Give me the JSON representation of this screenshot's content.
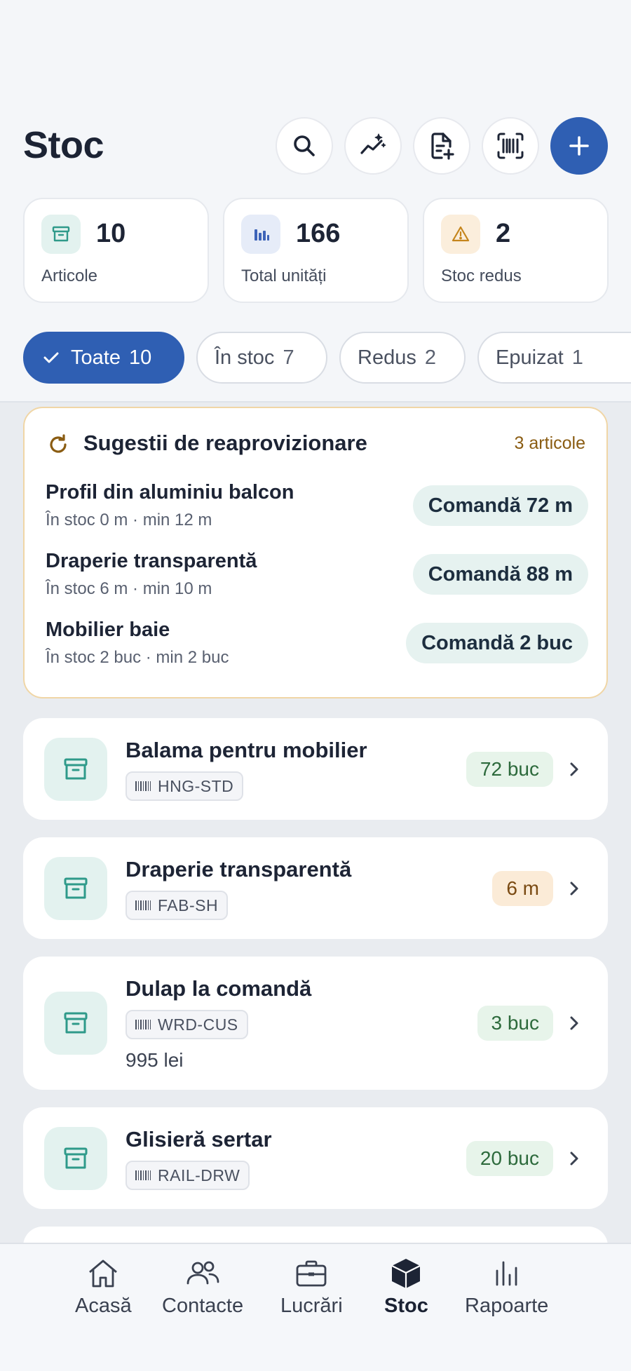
{
  "header": {
    "title": "Stoc",
    "buttons": [
      "search-icon",
      "trend-sparkle-icon",
      "add-document-icon",
      "barcode-scan-icon",
      "plus-icon"
    ]
  },
  "stats": [
    {
      "value": "10",
      "label": "Articole",
      "icon": "archive-icon",
      "color": "#2f9a8a"
    },
    {
      "value": "166",
      "label": "Total unități",
      "icon": "bar-chart-icon",
      "color": "#3d63b8"
    },
    {
      "value": "2",
      "label": "Stoc redus",
      "icon": "warning-icon",
      "color": "#c5851c"
    }
  ],
  "filters": [
    {
      "label": "Toate",
      "count": "10",
      "active": true
    },
    {
      "label": "În stoc",
      "count": "7"
    },
    {
      "label": "Redus",
      "count": "2"
    },
    {
      "label": "Epuizat",
      "count": "1"
    }
  ],
  "suggestions": {
    "title": "Sugestii de reaprovizionare",
    "count": "3 articole",
    "rows": [
      {
        "name": "Profil din aluminiu balcon",
        "sub": "În stoc 0 m · min 12 m",
        "action": "Comandă 72 m"
      },
      {
        "name": "Draperie transparentă",
        "sub": "În stoc 6 m · min 10 m",
        "action": "Comandă 88 m"
      },
      {
        "name": "Mobilier baie",
        "sub": "În stoc 2 buc · min 2 buc",
        "action": "Comandă 2 buc"
      }
    ]
  },
  "items": [
    {
      "name": "Balama pentru mobilier",
      "sku": "HNG-STD",
      "qty": "72 buc",
      "status": "ok"
    },
    {
      "name": "Draperie transparentă",
      "sku": "FAB-SH",
      "qty": "6 m",
      "status": "low"
    },
    {
      "name": "Dulap la comandă",
      "sku": "WRD-CUS",
      "price": "995 lei",
      "qty": "3 buc",
      "status": "ok"
    },
    {
      "name": "Glisieră sertar",
      "sku": "RAIL-DRW",
      "qty": "20 buc",
      "status": "ok"
    }
  ],
  "nav": [
    {
      "label": "Acasă",
      "icon": "home-icon"
    },
    {
      "label": "Contacte",
      "icon": "contacts-icon"
    },
    {
      "label": "Lucrări",
      "icon": "briefcase-icon"
    },
    {
      "label": "Stoc",
      "icon": "box-icon",
      "active": true
    },
    {
      "label": "Rapoarte",
      "icon": "reports-icon"
    }
  ],
  "colors": {
    "primary": "#2f5fb3",
    "teal": "#2f9a8a",
    "amber": "#c5851c",
    "background": "#f3f5f8"
  }
}
